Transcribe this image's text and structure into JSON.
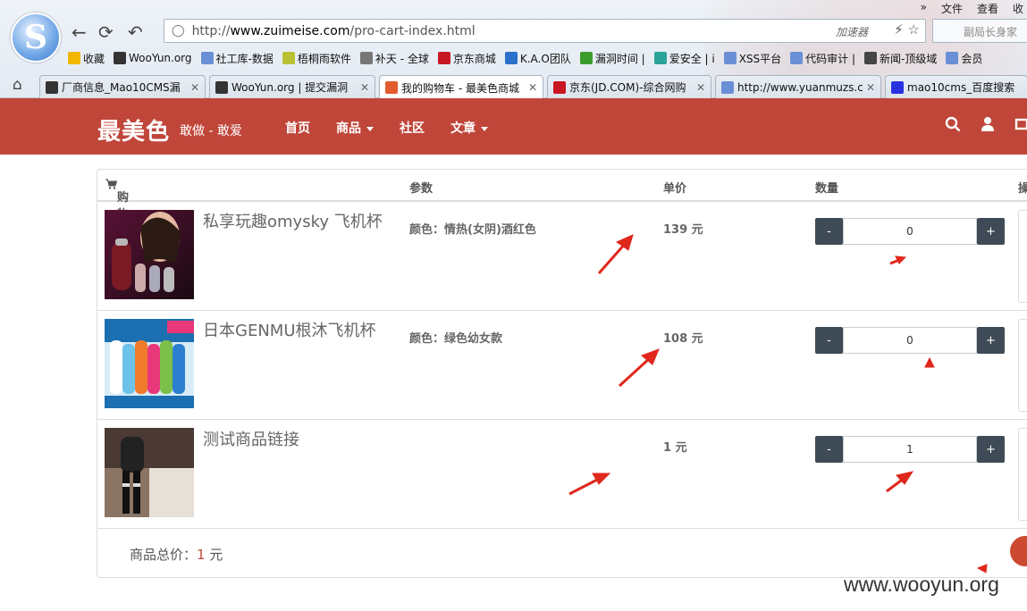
{
  "browser": {
    "menu_items": [
      "文件",
      "查看",
      "收"
    ],
    "menu_more": "»",
    "url_prefix": "http://",
    "url_domain": "www.zuimeise.com",
    "url_path": "/pro-cart-index.html",
    "accelerator": "加速器",
    "search_placeholder": "副局长身家",
    "bookmarks": [
      {
        "label": "收藏",
        "color": "#f2b705"
      },
      {
        "label": "WooYun.org",
        "color": "#333"
      },
      {
        "label": "社工库-数据",
        "color": "#6b8fd6"
      },
      {
        "label": "梧桐雨软件",
        "color": "#b9c234"
      },
      {
        "label": "补天 - 全球",
        "color": "#777"
      },
      {
        "label": "京东商城",
        "color": "#c81623"
      },
      {
        "label": "K.A.O团队",
        "color": "#2a6fc9"
      },
      {
        "label": "漏洞时间 |",
        "color": "#3b9c2c"
      },
      {
        "label": "爱安全 | i",
        "color": "#2aa39a"
      },
      {
        "label": "XSS平台",
        "color": "#6b8fd6"
      },
      {
        "label": "代码审计 |",
        "color": "#6b8fd6"
      },
      {
        "label": "新闻-顶级域",
        "color": "#444"
      },
      {
        "label": "会员",
        "color": "#6b8fd6"
      }
    ],
    "tabs": [
      {
        "label": "厂商信息_Mao10CMS漏",
        "color": "#333",
        "active": false
      },
      {
        "label": "WooYun.org | 提交漏洞",
        "color": "#333",
        "active": false
      },
      {
        "label": "我的购物车 - 最美色商城",
        "color": "#e25b2c",
        "active": true
      },
      {
        "label": "京东(JD.COM)-综合网购",
        "color": "#c81623",
        "active": false
      },
      {
        "label": "http://www.yuanmuzs.c",
        "color": "#6b8fd6",
        "active": false
      },
      {
        "label": "mao10cms_百度搜索",
        "color": "#2932e1",
        "active": false
      }
    ]
  },
  "site": {
    "brand": "最美色",
    "slogan": "敢做 - 敢爱",
    "menu": [
      {
        "label": "首页",
        "dropdown": false
      },
      {
        "label": "商品",
        "dropdown": true
      },
      {
        "label": "社区",
        "dropdown": false
      },
      {
        "label": "文章",
        "dropdown": true
      }
    ],
    "accent": "#c0463a"
  },
  "cart": {
    "headers": {
      "cart": "购物车",
      "params": "参数",
      "unit_price": "单价",
      "quantity": "数量",
      "ops": "操"
    },
    "items": [
      {
        "name": "私享玩趣omysky 飞机杯",
        "param": "颜色：情热(女阴)酒红色",
        "price": "139 元",
        "qty": "0"
      },
      {
        "name": "日本GENMU根沐飞机杯",
        "param": "颜色：绿色幼女款",
        "price": "108 元",
        "qty": "0"
      },
      {
        "name": "测试商品链接",
        "param": "",
        "price": "1 元",
        "qty": "1"
      }
    ],
    "minus": "-",
    "plus": "+",
    "total_label": "商品总价：",
    "total_value": "1",
    "total_unit": " 元"
  },
  "watermark": "www.wooyun.org"
}
